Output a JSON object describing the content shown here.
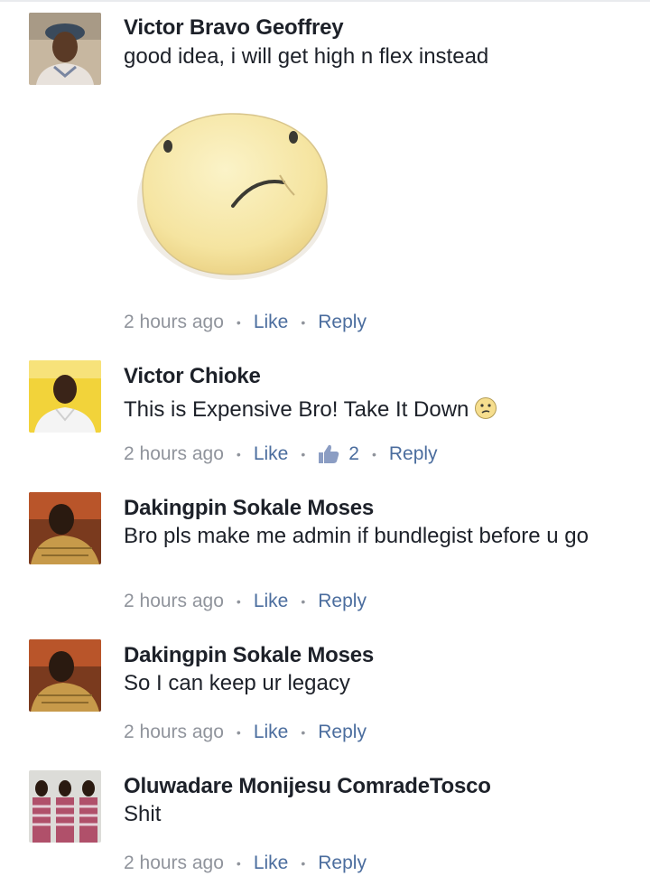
{
  "comments": [
    {
      "author": "Victor Bravo Geoffrey",
      "text": "good idea, i will get high n flex instead",
      "sticker": "confused-face-sticker",
      "time": "2 hours ago",
      "like": "Like",
      "reply": "Reply"
    },
    {
      "author": "Victor Chioke",
      "text": "This is Expensive Bro! Take It Down",
      "inline_emoji": "confused-emoji",
      "time": "2 hours ago",
      "like": "Like",
      "like_count": "2",
      "reply": "Reply"
    },
    {
      "author": "Dakingpin Sokale Moses",
      "text": "Bro pls make me admin if bundlegist before u go",
      "time": "2 hours ago",
      "like": "Like",
      "reply": "Reply"
    },
    {
      "author": "Dakingpin Sokale Moses",
      "text": "So I can keep ur legacy",
      "time": "2 hours ago",
      "like": "Like",
      "reply": "Reply"
    },
    {
      "author": "Oluwadare Monijesu ComradeTosco",
      "text": "Shit",
      "time": "2 hours ago",
      "like": "Like",
      "reply": "Reply"
    }
  ],
  "colors": {
    "link": "#4b6d9e",
    "meta": "#90949c",
    "text": "#1d2129"
  }
}
